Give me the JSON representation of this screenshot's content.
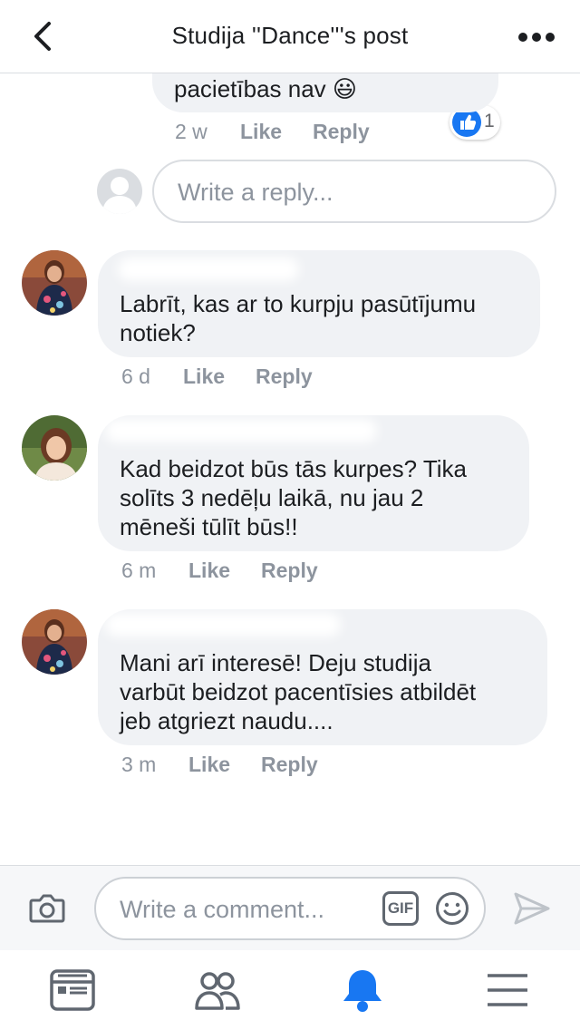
{
  "header": {
    "title": "Studija ''Dance'''s post"
  },
  "top_reply": {
    "text": "pacietības nav 😃",
    "time": "2 w",
    "like_label": "Like",
    "reply_label": "Reply",
    "reaction_count": "1"
  },
  "reply_input": {
    "placeholder": "Write a reply..."
  },
  "comments": [
    {
      "text_lines": [
        "Labrīt, kas ar to kurpju pasūtījumu",
        "notiek?"
      ],
      "time": "6 d",
      "like_label": "Like",
      "reply_label": "Reply"
    },
    {
      "text_lines": [
        "Kad beidzot būs tās kurpes? Tika",
        "solīts 3 nedēļu laikā, nu jau 2",
        "mēneši tūlīt būs!!"
      ],
      "time": "6 m",
      "like_label": "Like",
      "reply_label": "Reply"
    },
    {
      "text_lines": [
        "Mani arī interesē! Deju studija",
        "varbūt beidzot pacentīsies atbildēt",
        "jeb atgriezt naudu...."
      ],
      "time": "3 m",
      "like_label": "Like",
      "reply_label": "Reply"
    }
  ],
  "comment_input": {
    "placeholder": "Write a comment...",
    "gif_label": "GIF"
  },
  "colors": {
    "accent": "#1877f2",
    "bubble": "#f0f2f5",
    "meta_text": "#8d949e"
  },
  "icons": {
    "header": [
      "back-arrow-icon",
      "more-dots-icon"
    ],
    "comment_bar": [
      "camera-icon",
      "gif-icon",
      "emoji-icon",
      "send-icon"
    ],
    "tabs": [
      "news-feed-icon",
      "friends-icon",
      "notifications-bell-icon",
      "menu-icon"
    ],
    "active_tab": "notifications-bell-icon"
  }
}
